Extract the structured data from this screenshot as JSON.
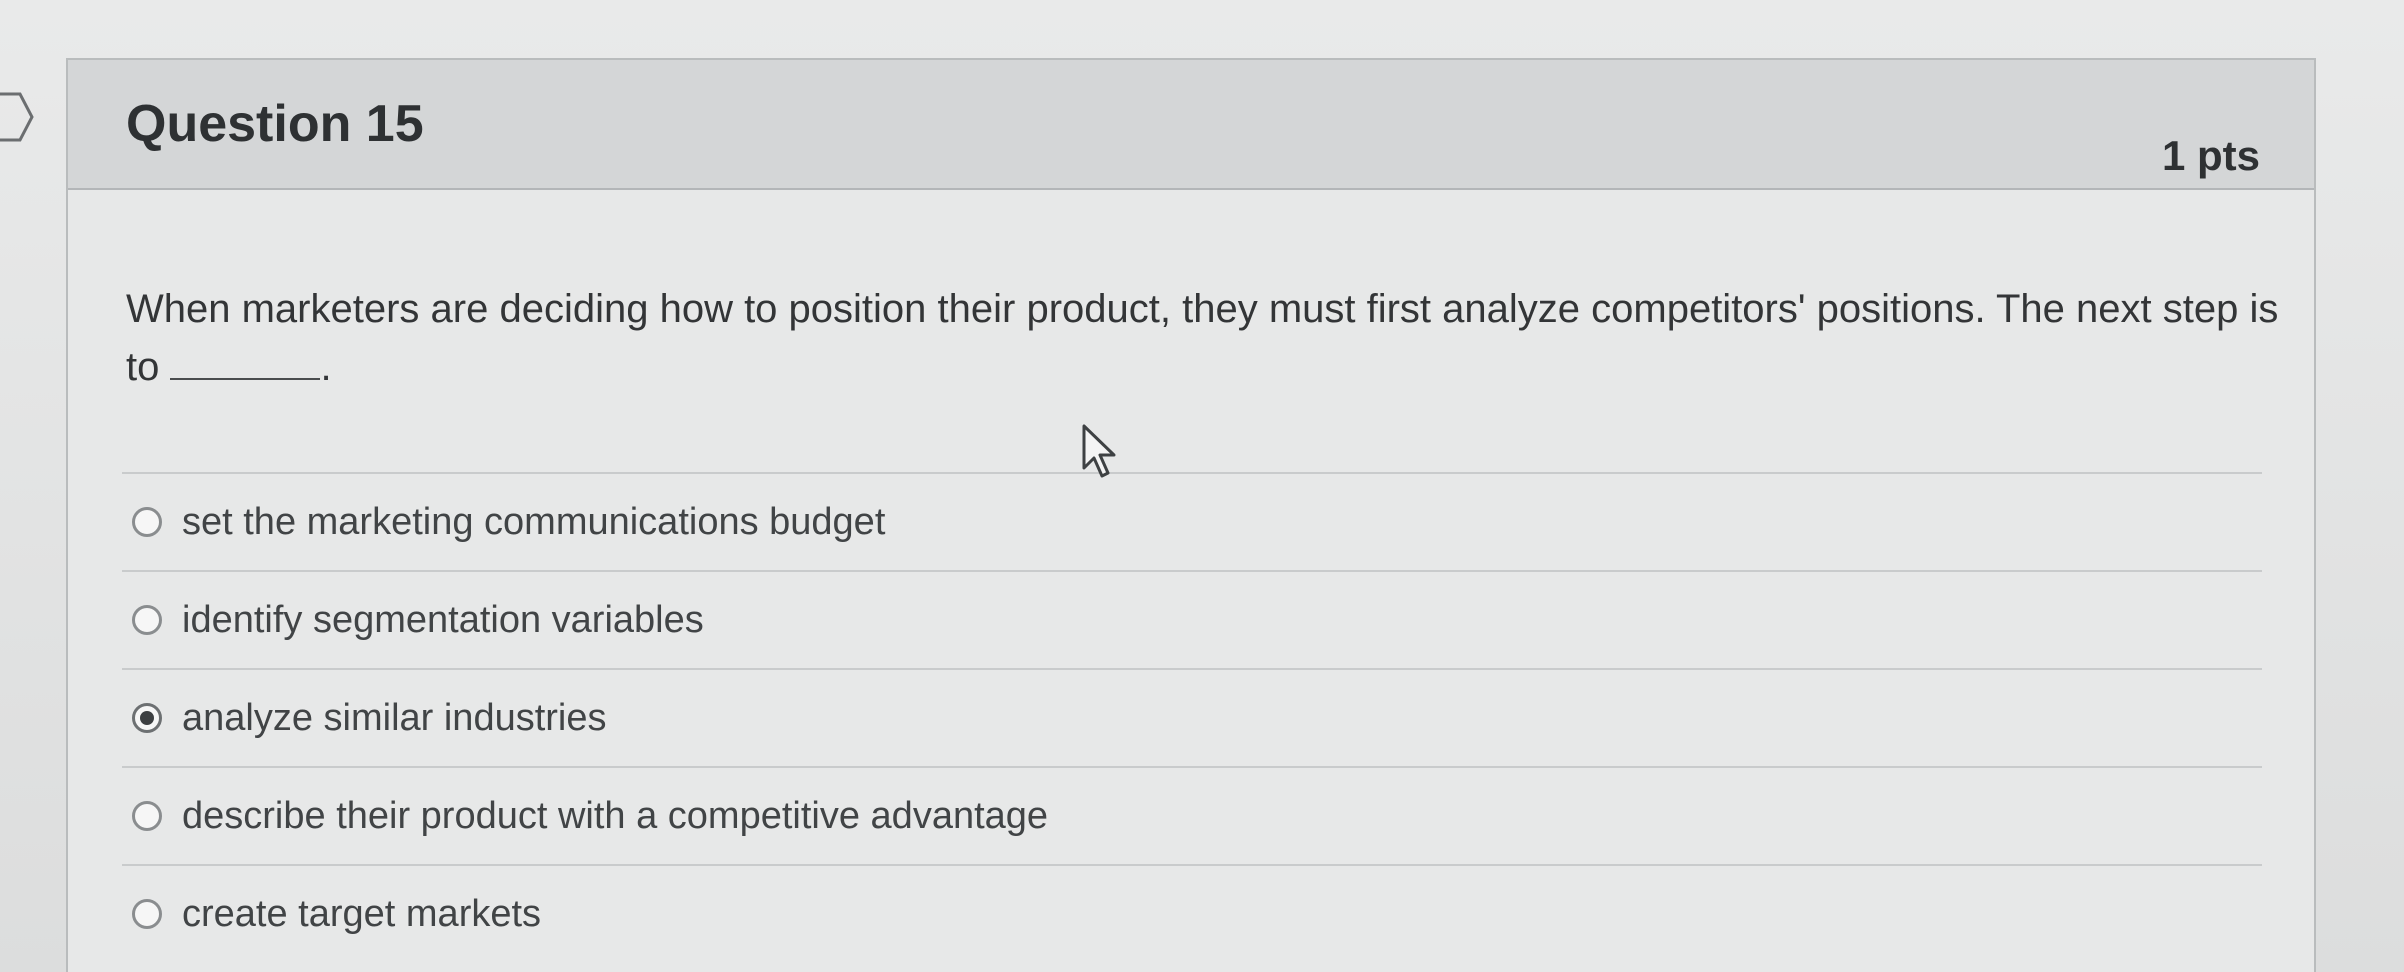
{
  "question": {
    "title": "Question 15",
    "points": "1 pts",
    "text_before_blank": "When marketers are deciding how to position their product, they must first analyze competitors' positions. The next step is to ",
    "text_after_blank": "."
  },
  "answers": [
    {
      "label": "set the marketing communications budget",
      "selected": false
    },
    {
      "label": "identify segmentation variables",
      "selected": false
    },
    {
      "label": "analyze similar industries",
      "selected": true
    },
    {
      "label": "describe their product with a competitive advantage",
      "selected": false
    },
    {
      "label": "create target markets",
      "selected": false
    }
  ],
  "icons": {
    "flag": "flag-outline-icon",
    "cursor": "mouse-pointer-icon"
  },
  "colors": {
    "header_bg": "#d4d6d7",
    "selected_radio": "#3c3f41"
  }
}
